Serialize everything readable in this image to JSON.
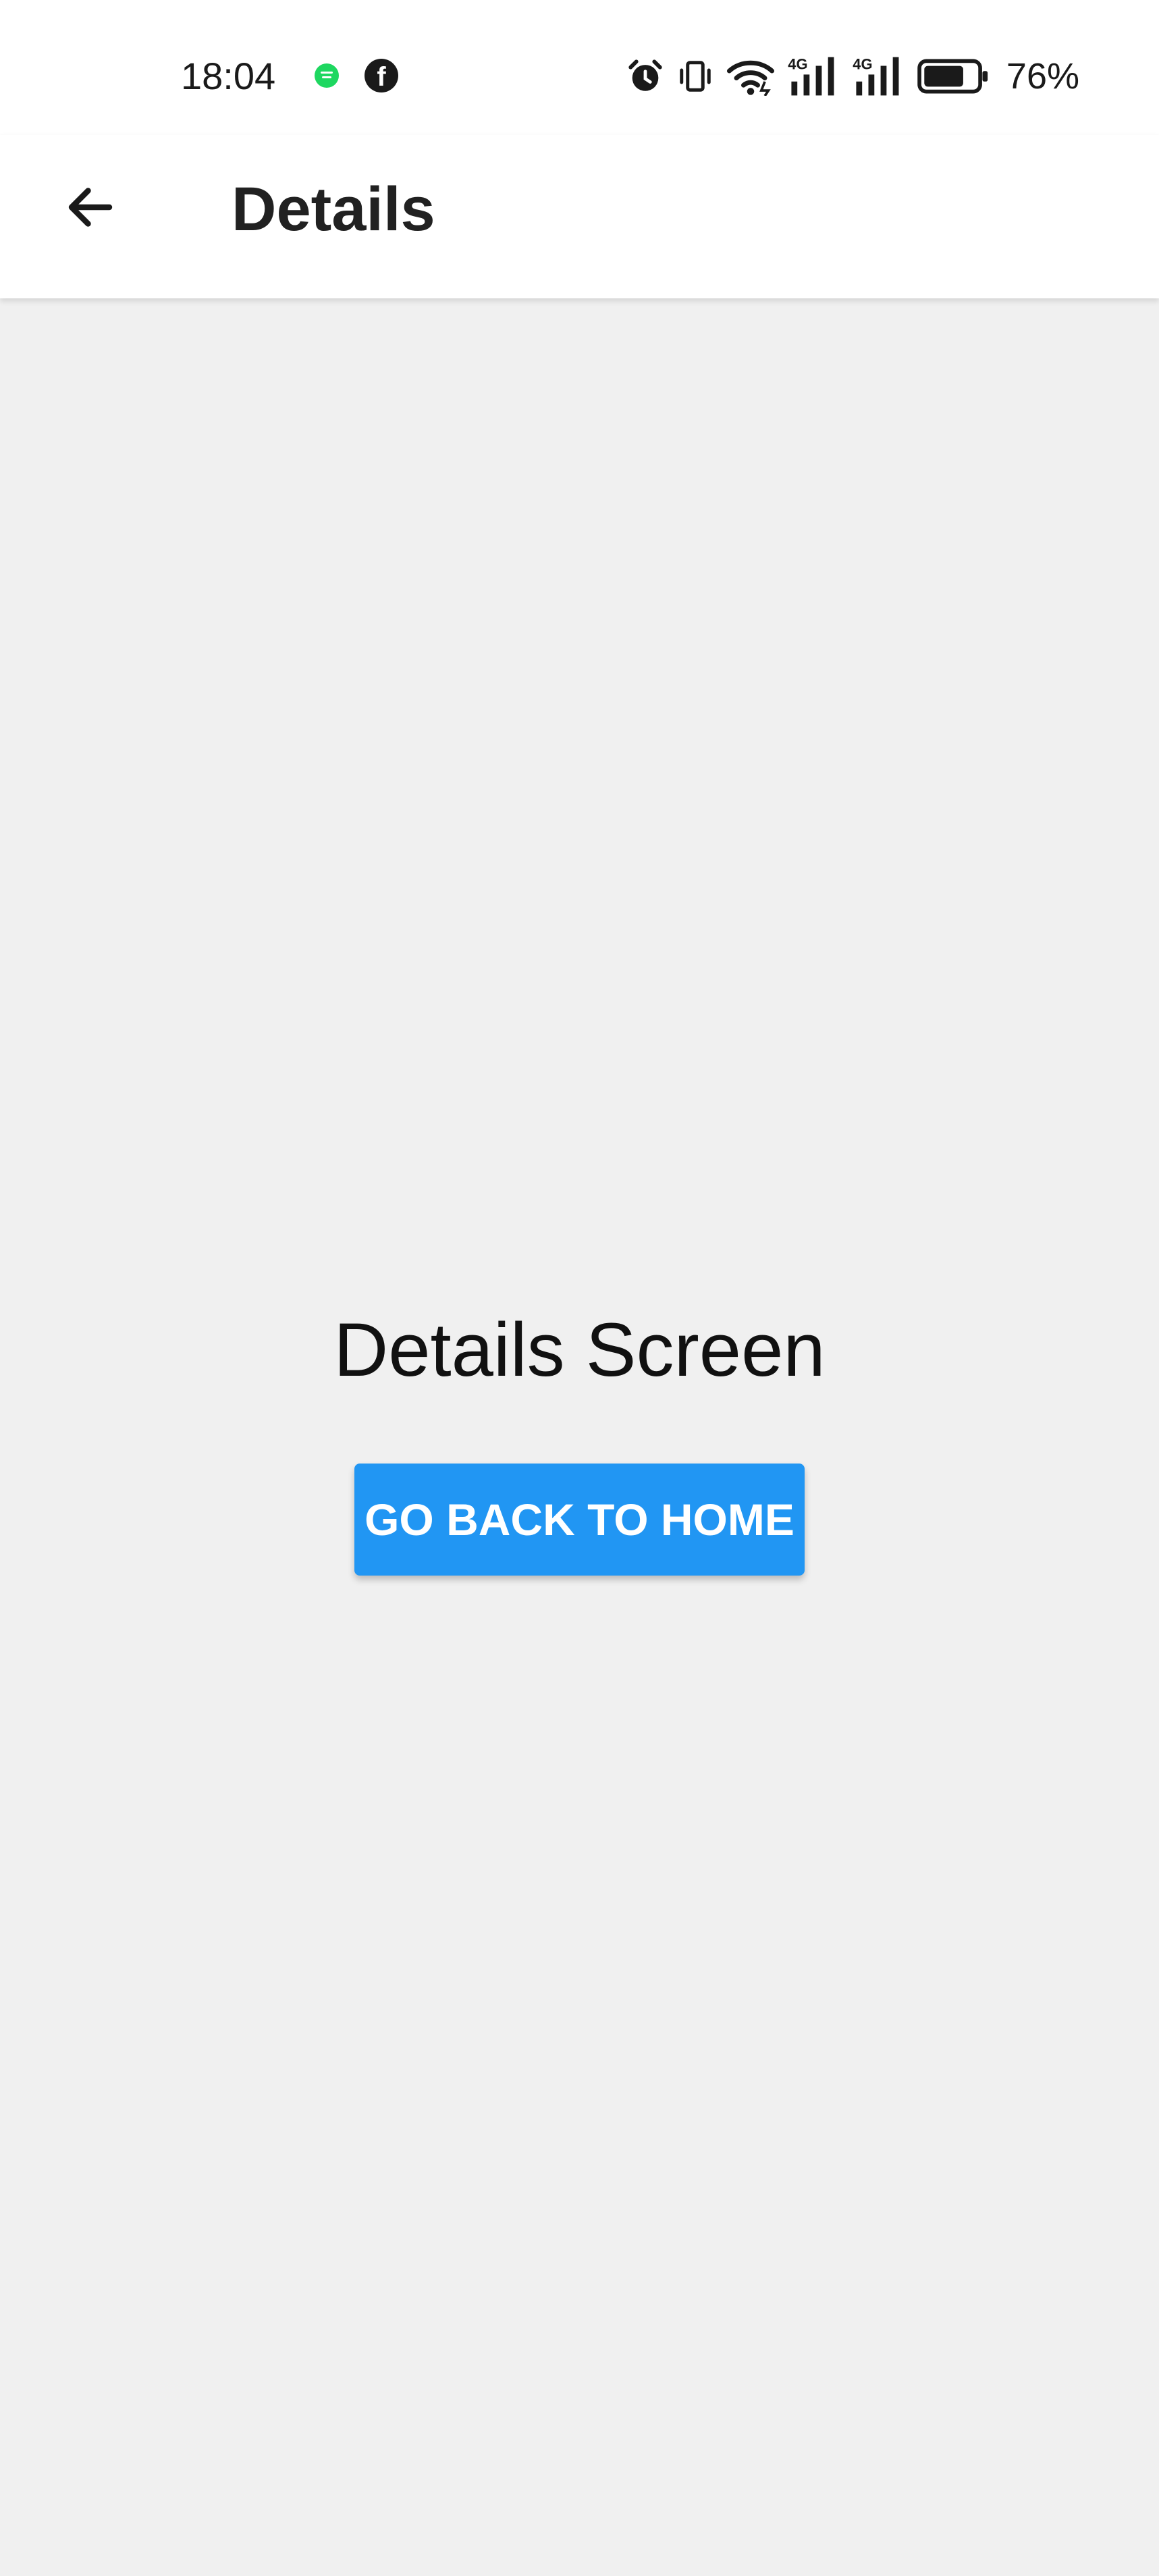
{
  "status_bar": {
    "time": "18:04",
    "notifications": [
      "spotify-icon",
      "facebook-icon"
    ],
    "icons": [
      "alarm-icon",
      "vibrate-icon",
      "wifi-icon",
      "signal-4g-icon",
      "signal-4g-icon",
      "battery-icon"
    ],
    "facebook_glyph": "f",
    "battery_percent": "76%",
    "battery_level": 0.76,
    "spotify_color": "#1ed760",
    "signal_label_1": "4G",
    "signal_label_2": "4G"
  },
  "app_bar": {
    "title": "Details",
    "back_icon": "arrow-left-icon"
  },
  "main": {
    "screen_label": "Details Screen",
    "home_button_label": "GO BACK TO HOME"
  },
  "colors": {
    "accent": "#2196f3",
    "background": "#f0f0f0",
    "app_bar": "#ffffff"
  }
}
